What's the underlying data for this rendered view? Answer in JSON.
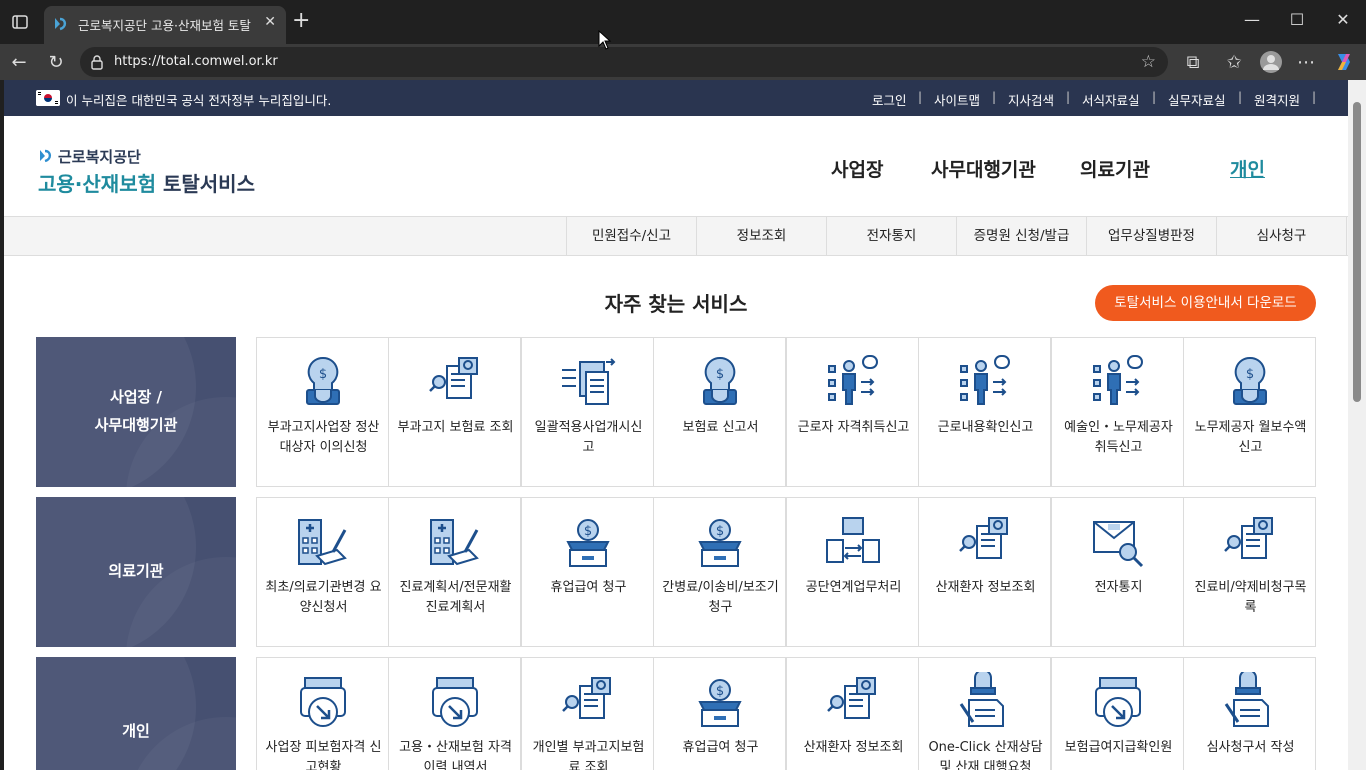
{
  "browser": {
    "tab_title": "근로복지공단 고용·산재보험 토탈",
    "tab_close": "✕",
    "new_tab": "+",
    "url": "https://total.comwel.or.kr",
    "win_min": "—",
    "win_max": "☐",
    "win_close": "✕"
  },
  "gov_bar": {
    "notice": "이 누리집은 대한민국 공식 전자정부 누리집입니다.",
    "links": [
      "로그인",
      "사이트맵",
      "지사검색",
      "서식자료실",
      "실무자료실",
      "원격지원"
    ],
    "separator": "|"
  },
  "logo": {
    "top": "근로복지공단",
    "bottom_a": "고용·산재보험",
    "bottom_b": "토탈서비스"
  },
  "main_nav": [
    "사업장",
    "사무대행기관",
    "의료기관",
    "개인"
  ],
  "sub_nav": [
    "민원접수/신고",
    "정보조회",
    "전자통지",
    "증명원 신청/발급",
    "업무상질병판정",
    "심사청구"
  ],
  "section_title": "자주 찾는 서비스",
  "download_button": "토탈서비스 이용안내서 다운로드",
  "rows": [
    {
      "label_line1": "사업장 /",
      "label_line2": "사무대행기관",
      "cards": [
        {
          "label": "부과고지사업장 정산대상자 이의신청",
          "icon": "money-bulb-icon"
        },
        {
          "label": "부과고지 보험료 조회",
          "icon": "document-search-icon"
        },
        {
          "label": "일괄적용사업개시신고",
          "icon": "document-transfer-icon"
        },
        {
          "label": "보험료 신고서",
          "icon": "money-bulb-icon"
        },
        {
          "label": "근로자 자격취득신고",
          "icon": "worker-list-icon"
        },
        {
          "label": "근로내용확인신고",
          "icon": "worker-list-icon"
        },
        {
          "label": "예술인・노무제공자 취득신고",
          "icon": "worker-list-icon"
        },
        {
          "label": "노무제공자 월보수액 신고",
          "icon": "money-bulb-icon"
        }
      ]
    },
    {
      "label_line1": "의료기관",
      "label_line2": "",
      "cards": [
        {
          "label": "최초/의료기관변경 요양신청서",
          "icon": "hospital-document-icon"
        },
        {
          "label": "진료계획서/전문재활진료계획서",
          "icon": "hospital-document-icon"
        },
        {
          "label": "휴업급여 청구",
          "icon": "money-box-icon"
        },
        {
          "label": "간병료/이송비/보조기 청구",
          "icon": "money-box-icon"
        },
        {
          "label": "공단연계업무처리",
          "icon": "document-exchange-icon"
        },
        {
          "label": "산재환자 정보조회",
          "icon": "document-search-icon"
        },
        {
          "label": "전자통지",
          "icon": "mail-search-icon"
        },
        {
          "label": "진료비/약제비청구목록",
          "icon": "document-search-icon"
        }
      ]
    },
    {
      "label_line1": "개인",
      "label_line2": "",
      "cards": [
        {
          "label": "사업장 피보험자격 신고현황",
          "icon": "printer-download-icon"
        },
        {
          "label": "고용・산재보험 자격 이력 내역서",
          "icon": "printer-download-icon"
        },
        {
          "label": "개인별 부과고지보험료 조회",
          "icon": "document-search-icon"
        },
        {
          "label": "휴업급여 청구",
          "icon": "money-box-icon"
        },
        {
          "label": "산재환자 정보조회",
          "icon": "document-search-icon"
        },
        {
          "label": "One-Click 산재상담 및 산재 대행요청",
          "icon": "stamp-document-icon"
        },
        {
          "label": "보험급여지급확인원",
          "icon": "printer-download-icon"
        },
        {
          "label": "심사청구서 작성",
          "icon": "stamp-document-icon"
        }
      ]
    }
  ],
  "colors": {
    "accent": "#1f8b9e",
    "navy": "#465071",
    "orange": "#f05a1e",
    "icon_blue": "#2f6fb5",
    "icon_light": "#b9d3ee"
  }
}
